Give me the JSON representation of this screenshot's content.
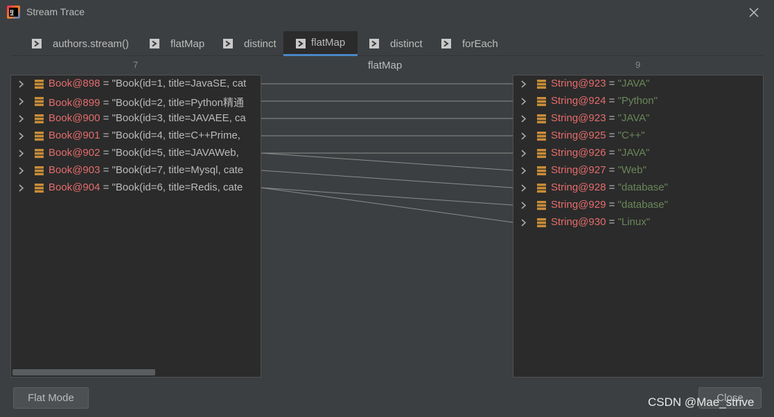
{
  "window": {
    "title": "Stream Trace",
    "close_icon": "close-icon"
  },
  "tabs": [
    {
      "label": "authors.stream()",
      "active": false
    },
    {
      "label": "flatMap",
      "active": false
    },
    {
      "label": "distinct",
      "active": false
    },
    {
      "label": "flatMap",
      "active": true
    },
    {
      "label": "distinct",
      "active": false
    },
    {
      "label": "forEach",
      "active": false
    }
  ],
  "left_panel": {
    "count": "7",
    "items": [
      {
        "name": "Book@898",
        "eq": " = ",
        "value": "\"Book(id=1, title=JavaSE, cat"
      },
      {
        "name": "Book@899",
        "eq": " = ",
        "value": "\"Book(id=2, title=Python精通"
      },
      {
        "name": "Book@900",
        "eq": " = ",
        "value": "\"Book(id=3, title=JAVAEE, ca"
      },
      {
        "name": "Book@901",
        "eq": " = ",
        "value": "\"Book(id=4, title=C++Prime,"
      },
      {
        "name": "Book@902",
        "eq": " = ",
        "value": "\"Book(id=5, title=JAVAWeb,"
      },
      {
        "name": "Book@903",
        "eq": " = ",
        "value": "\"Book(id=7, title=Mysql, cate"
      },
      {
        "name": "Book@904",
        "eq": " = ",
        "value": "\"Book(id=6, title=Redis, cate"
      }
    ]
  },
  "middle": {
    "label": "flatMap"
  },
  "right_panel": {
    "count": "9",
    "items": [
      {
        "name": "String@923",
        "eq": " = ",
        "value": "\"JAVA\""
      },
      {
        "name": "String@924",
        "eq": " = ",
        "value": "\"Python\""
      },
      {
        "name": "String@923",
        "eq": " = ",
        "value": "\"JAVA\""
      },
      {
        "name": "String@925",
        "eq": " = ",
        "value": "\"C++\""
      },
      {
        "name": "String@926",
        "eq": " = ",
        "value": "\"JAVA\""
      },
      {
        "name": "String@927",
        "eq": " = ",
        "value": "\"Web\""
      },
      {
        "name": "String@928",
        "eq": " = ",
        "value": "\"database\""
      },
      {
        "name": "String@929",
        "eq": " = ",
        "value": "\"database\""
      },
      {
        "name": "String@930",
        "eq": " = ",
        "value": "\"Linux\""
      }
    ]
  },
  "mappings": [
    [
      0,
      0
    ],
    [
      1,
      1
    ],
    [
      2,
      2
    ],
    [
      3,
      3
    ],
    [
      4,
      4
    ],
    [
      4,
      5
    ],
    [
      5,
      6
    ],
    [
      6,
      7
    ],
    [
      6,
      8
    ]
  ],
  "buttons": {
    "flat_mode": "Flat Mode",
    "close": "Close"
  },
  "watermark": "CSDN @Mae_strive",
  "colors": {
    "object_name": "#e66c6c",
    "string_value": "#6a8759",
    "active_tab_underline": "#4a88c7",
    "background": "#3c3f41",
    "panel": "#2b2b2b"
  }
}
